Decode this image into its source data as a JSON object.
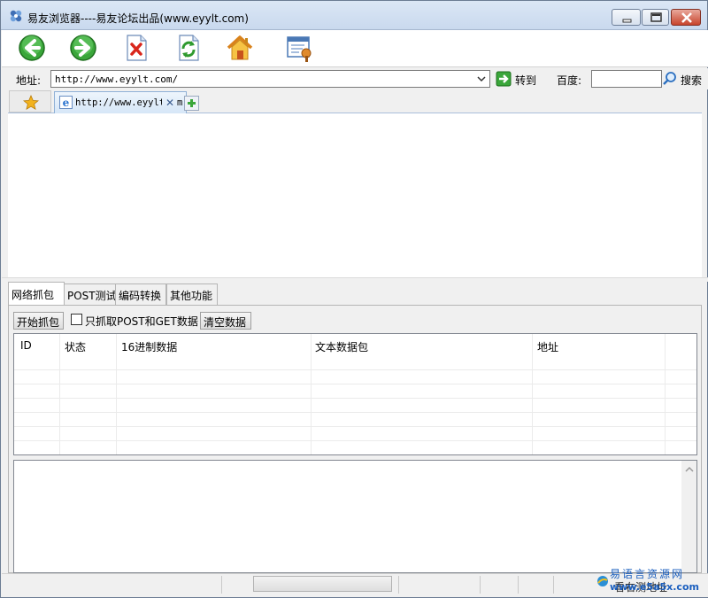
{
  "window": {
    "title": "易友浏览器----易友论坛出品(www.eyylt.com)"
  },
  "toolbar": {
    "buttons": [
      "back-icon",
      "forward-icon",
      "stop-icon",
      "refresh-icon",
      "home-icon",
      "settings-window-icon"
    ]
  },
  "address_bar": {
    "label": "地址:",
    "value": "http://www.eyylt.com/",
    "go_label": "转到",
    "baidu_label": "百度:",
    "baidu_value": "",
    "search_label": "搜索"
  },
  "browser_tabs": {
    "favorites_icon": "star-icon",
    "active_tab": {
      "title": "http://www.eyylt",
      "tail": "m"
    }
  },
  "function_tabs": [
    "网络抓包",
    "POST测试",
    "编码转换",
    "其他功能"
  ],
  "capture_panel": {
    "start_button": "开始抓包",
    "filter_checkbox_label": "只抓取POST和GET数据",
    "filter_checked": false,
    "clear_button": "清空数据",
    "columns": [
      "ID",
      "状态",
      "16进制数据",
      "文本数据包",
      "地址"
    ],
    "rows": []
  },
  "status_bar": {
    "text": "看右测地址"
  },
  "watermark": {
    "line1": "易语言资源网",
    "line2": "www.e5a5x.com"
  },
  "colors": {
    "accent": "#1b5fbf",
    "title_gradient_top": "#dbe7f5",
    "close_button": "#c8442c"
  }
}
